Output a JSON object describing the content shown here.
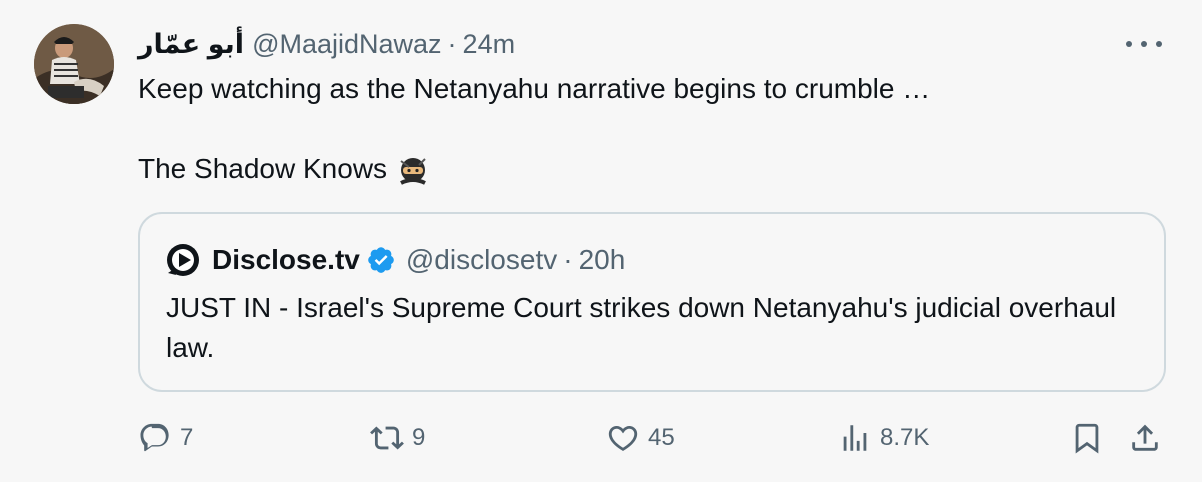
{
  "tweet": {
    "display_name": "أبو عمّار",
    "handle": "@MaajidNawaz",
    "separator": "·",
    "time": "24m",
    "lines": [
      "Keep watching as the Netanyahu narrative begins to crumble …",
      "",
      "The Shadow Knows"
    ],
    "emoji_icon": "ninja-emoji-icon"
  },
  "quote": {
    "name": "Disclose.tv",
    "handle": "@disclosetv",
    "separator": "·",
    "time": "20h",
    "text": "JUST IN - Israel's Supreme Court strikes down Netanyahu's judicial overhaul law.",
    "logo_icon": "play-logo-icon",
    "verified_color": "#1d9bf0"
  },
  "actions": {
    "replies": "7",
    "retweets": "9",
    "likes": "45",
    "views": "8.7K"
  },
  "colors": {
    "text": "#0f1419",
    "secondary": "#536471",
    "border": "#cfd9de",
    "background": "#f7f7f7",
    "verified": "#1d9bf0"
  }
}
